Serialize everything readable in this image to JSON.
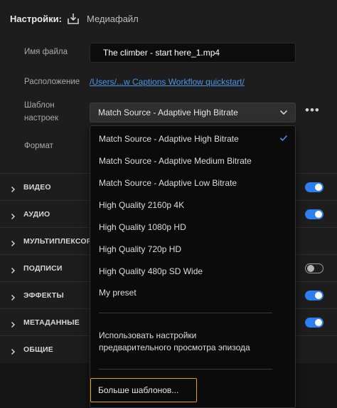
{
  "header": {
    "title": "Настройки:",
    "media_label": "Медиафайл"
  },
  "form": {
    "filename_label": "Имя файла",
    "filename_value": "The climber - start here_1.mp4",
    "location_label": "Расположение",
    "location_value": "/Users/...w Captions Workflow quickstart/",
    "preset_label_line1": "Шаблон",
    "preset_label_line2": "настроек",
    "preset_selected": "Match Source - Adaptive High Bitrate",
    "format_label": "Формат",
    "more_label": "•••"
  },
  "sections": [
    {
      "label": "ВИДЕО",
      "toggle": "on"
    },
    {
      "label": "АУДИО",
      "toggle": "on"
    },
    {
      "label": "МУЛЬТИПЛЕКСОР",
      "toggle": "none"
    },
    {
      "label": "ПОДПИСИ",
      "toggle": "off"
    },
    {
      "label": "ЭФФЕКТЫ",
      "toggle": "on"
    },
    {
      "label": "МЕТАДАННЫЕ",
      "toggle": "on"
    },
    {
      "label": "ОБЩИЕ",
      "toggle": "none"
    }
  ],
  "dropdown": {
    "options": [
      "Match Source - Adaptive High Bitrate",
      "Match Source - Adaptive Medium Bitrate",
      "Match Source - Adaptive Low Bitrate",
      "High Quality 2160p 4K",
      "High Quality 1080p HD",
      "High Quality 720p HD",
      "High Quality 480p SD Wide",
      "My preset"
    ],
    "checked_index": 0,
    "preview_settings_line1": "Использовать настройки",
    "preview_settings_line2": "предварительного просмотра эпизода",
    "more_presets": "Больше шаблонов..."
  },
  "colors": {
    "accent": "#2d7ff0",
    "link": "#4a94e8",
    "focus": "#e3a21a"
  }
}
